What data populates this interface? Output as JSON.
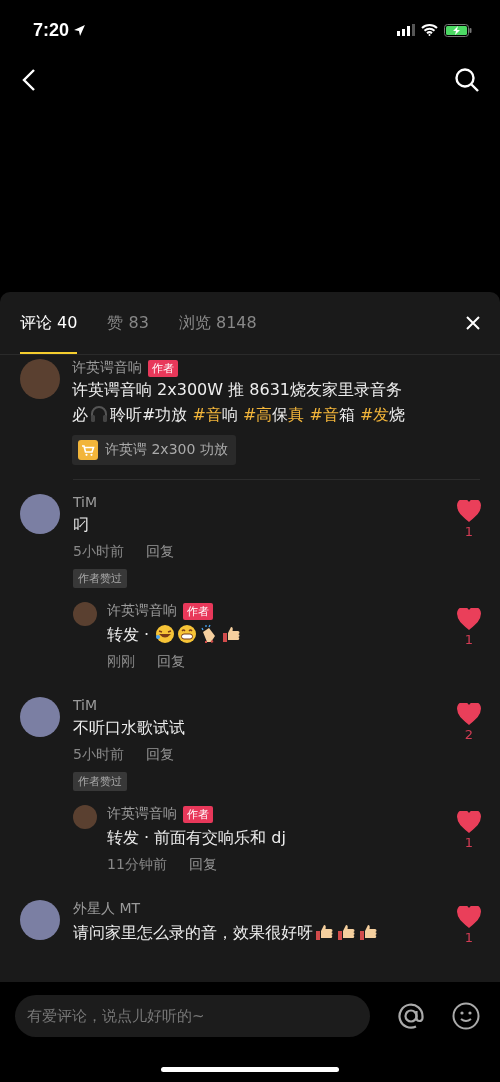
{
  "status_bar": {
    "time": "7:20"
  },
  "tabs": [
    {
      "label": "评论 40",
      "selected": true
    },
    {
      "label": "赞 83",
      "selected": false
    },
    {
      "label": "浏览 8148",
      "selected": false
    }
  ],
  "post": {
    "author": "许英谔音响",
    "badge": "作者",
    "lines": [
      [
        {
          "kind": "text",
          "segments": [
            {
              "text": "许英谔音响 2x300W 推 8631烧友家里录音务",
              "highlight": false
            }
          ]
        }
      ],
      [
        {
          "kind": "text",
          "segments": [
            {
              "text": "必",
              "highlight": false
            }
          ]
        },
        {
          "kind": "headphones"
        },
        {
          "kind": "text",
          "segments": [
            {
              "text": "聆听#功放 ",
              "highlight": false
            },
            {
              "text": "#音",
              "highlight": true
            },
            {
              "text": "响 ",
              "highlight": false
            },
            {
              "text": "#高",
              "highlight": true
            },
            {
              "text": "保",
              "highlight": false
            },
            {
              "text": "真 #音",
              "highlight": true
            },
            {
              "text": "箱 ",
              "highlight": false
            },
            {
              "text": "#发",
              "highlight": true
            },
            {
              "text": "烧",
              "highlight": false
            }
          ]
        }
      ]
    ],
    "product": "许英谔 2x300 功放"
  },
  "comments": [
    {
      "user": "TiM",
      "content": [
        {
          "kind": "text",
          "segments": [
            {
              "text": "叼",
              "highlight": false
            }
          ]
        }
      ],
      "time": "5小时前",
      "reply": "回复",
      "tag": "作者赞过",
      "likes": "1",
      "liked": true,
      "replies": [
        {
          "user": "许英谔音响",
          "badge": "作者",
          "content": [
            {
              "kind": "text",
              "segments": [
                {
                  "text": "转发 · ",
                  "highlight": false
                }
              ]
            },
            {
              "kind": "laughing"
            },
            {
              "kind": "grinning"
            },
            {
              "kind": "clapping"
            },
            {
              "kind": "thumbs"
            }
          ],
          "time": "刚刚",
          "reply": "回复",
          "likes": "1",
          "liked": true
        }
      ]
    },
    {
      "user": "TiM",
      "content": [
        {
          "kind": "text",
          "segments": [
            {
              "text": "不听口水歌试试",
              "highlight": false
            }
          ]
        }
      ],
      "time": "5小时前",
      "reply": "回复",
      "tag": "作者赞过",
      "likes": "2",
      "liked": true,
      "replies": [
        {
          "user": "许英谔音响",
          "badge": "作者",
          "content": [
            {
              "kind": "text",
              "segments": [
                {
                  "text": "转发 · 前面有交响乐和 dj",
                  "highlight": false
                }
              ]
            }
          ],
          "time": "11分钟前",
          "reply": "回复",
          "likes": "1",
          "liked": true
        }
      ]
    },
    {
      "user": "外星人 MT",
      "content": [
        {
          "kind": "text",
          "segments": [
            {
              "text": "请问家里怎么录的音，效果很好呀",
              "highlight": false
            }
          ]
        },
        {
          "kind": "thumbs"
        },
        {
          "kind": "thumbs"
        },
        {
          "kind": "thumbs"
        }
      ],
      "likes": "1",
      "liked": true
    }
  ],
  "input": {
    "placeholder": "有爱评论，说点儿好听的~"
  }
}
